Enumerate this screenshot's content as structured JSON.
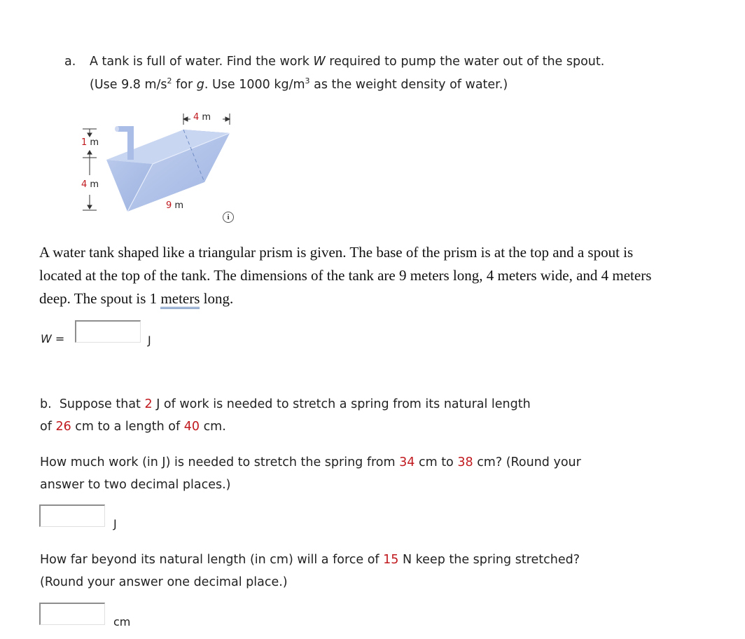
{
  "part_a": {
    "label": "a.",
    "question_line1_before": "A tank is full of water. Find the work ",
    "question_var": "W",
    "question_line1_after": " required to pump the water out of the spout.",
    "question_line2_p1": "(Use 9.8 m/s",
    "question_line2_sup1": "2",
    "question_line2_p2": " for ",
    "question_line2_var": "g",
    "question_line2_p3": ". Use 1000 kg/m",
    "question_line2_sup2": "3",
    "question_line2_p4": " as the weight density of water.)",
    "figure": {
      "width_label_value": "4",
      "width_label_unit": "m",
      "spout_label_value": "1",
      "spout_label_unit": "m",
      "depth_label_value": "4",
      "depth_label_unit": "m",
      "length_label_value": "9",
      "length_label_unit": "m",
      "info_icon": "i"
    },
    "description_p1": "A water tank shaped like a triangular prism is given. The base of the prism is at the top and a spout is located at the top of the tank. The dimensions of the tank are 9 meters long, 4 meters wide, and 4 meters deep. The spout is 1 ",
    "description_link": "meters",
    "description_p2": " long.",
    "answer_label_var": "W",
    "answer_label_eq": " =",
    "answer_value": "",
    "answer_unit": "J"
  },
  "part_b": {
    "label": "b.",
    "intro_p1": "Suppose that ",
    "work_value": "2",
    "intro_p2": " J of work is needed to stretch a spring from its natural length",
    "intro_p3": "of ",
    "natural_length": "26",
    "intro_p4": " cm to a length of ",
    "stretched_length": "40",
    "intro_p5": " cm.",
    "q1_p1": "How much work (in J) is needed to stretch the spring from ",
    "q1_from": "34",
    "q1_p2": " cm to ",
    "q1_to": "38",
    "q1_p3": " cm? (Round your",
    "q1_p4": "answer to two decimal places.)",
    "q1_answer_value": "",
    "q1_unit": "J",
    "q2_p1": "How far beyond its natural length (in cm) will a force of ",
    "q2_force": "15",
    "q2_p2": " N keep the spring stretched?",
    "q2_p3": "(Round your answer one decimal place.)",
    "q2_answer_value": "",
    "q2_unit": "cm"
  },
  "colors": {
    "highlight": "#c0191e",
    "tank_fill": "#aebfe6",
    "tank_dark": "#8ea6d8"
  }
}
